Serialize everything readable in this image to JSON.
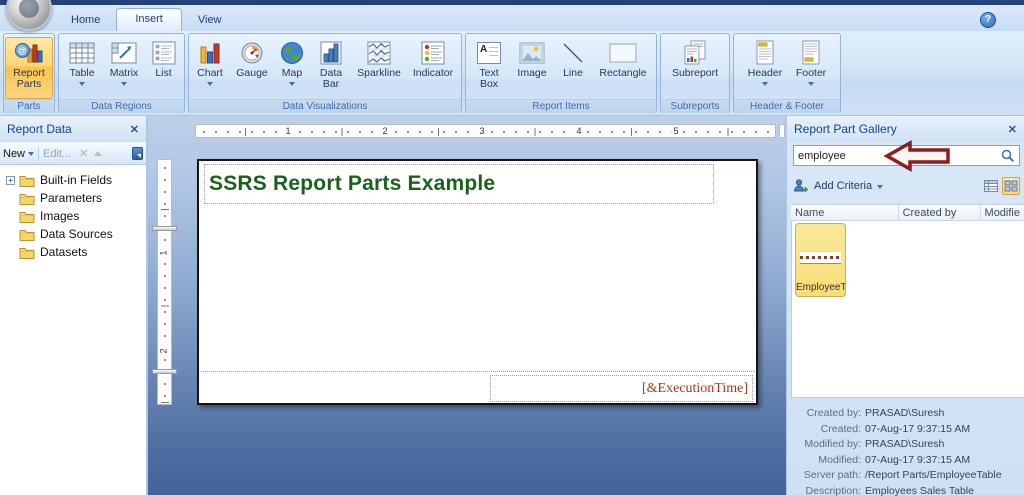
{
  "icons": {
    "close": "✕",
    "help": "?",
    "at": "@",
    "letter_a": "A",
    "plus": "+"
  },
  "tabs": [
    {
      "label": "Home"
    },
    {
      "label": "Insert"
    },
    {
      "label": "View"
    }
  ],
  "ribbon": {
    "groups": [
      {
        "label": "Parts",
        "buttons": [
          {
            "label": "Report Parts"
          }
        ]
      },
      {
        "label": "Data Regions",
        "buttons": [
          {
            "label": "Table"
          },
          {
            "label": "Matrix"
          },
          {
            "label": "List"
          }
        ]
      },
      {
        "label": "Data Visualizations",
        "buttons": [
          {
            "label": "Chart"
          },
          {
            "label": "Gauge"
          },
          {
            "label": "Map"
          },
          {
            "label": "Data Bar"
          },
          {
            "label": "Sparkline"
          },
          {
            "label": "Indicator"
          }
        ]
      },
      {
        "label": "Report Items",
        "buttons": [
          {
            "label": "Text Box"
          },
          {
            "label": "Image"
          },
          {
            "label": "Line"
          },
          {
            "label": "Rectangle"
          }
        ]
      },
      {
        "label": "Subreports",
        "buttons": [
          {
            "label": "Subreport"
          }
        ]
      },
      {
        "label": "Header & Footer",
        "buttons": [
          {
            "label": "Header"
          },
          {
            "label": "Footer"
          }
        ]
      }
    ]
  },
  "report_data": {
    "title": "Report Data",
    "toolbar": {
      "new": "New",
      "edit": "Edit..."
    },
    "tree": [
      "Built-in Fields",
      "Parameters",
      "Images",
      "Data Sources",
      "Datasets"
    ]
  },
  "design": {
    "h_ruler": [
      "1",
      "2",
      "3",
      "4",
      "5"
    ],
    "v_ruler": [
      "1",
      "2"
    ],
    "title": "SSRS Report Parts Example",
    "footer_expression": "[&ExecutionTime]"
  },
  "gallery": {
    "title": "Report Part Gallery",
    "search_value": "employee",
    "add_criteria": "Add Criteria",
    "columns": [
      "Name",
      "Created by",
      "Modifie"
    ],
    "item": {
      "name": "EmployeeTa..."
    },
    "details": [
      {
        "label": "Created by:",
        "value": "PRASAD\\Suresh"
      },
      {
        "label": "Created:",
        "value": "07-Aug-17 9:37:15 AM"
      },
      {
        "label": "Modified by:",
        "value": "PRASAD\\Suresh"
      },
      {
        "label": "Modified:",
        "value": "07-Aug-17 9:37:15 AM"
      },
      {
        "label": "Server path:",
        "value": "/Report Parts/EmployeeTable"
      },
      {
        "label": "Description:",
        "value": "Employees Sales Table"
      }
    ]
  }
}
